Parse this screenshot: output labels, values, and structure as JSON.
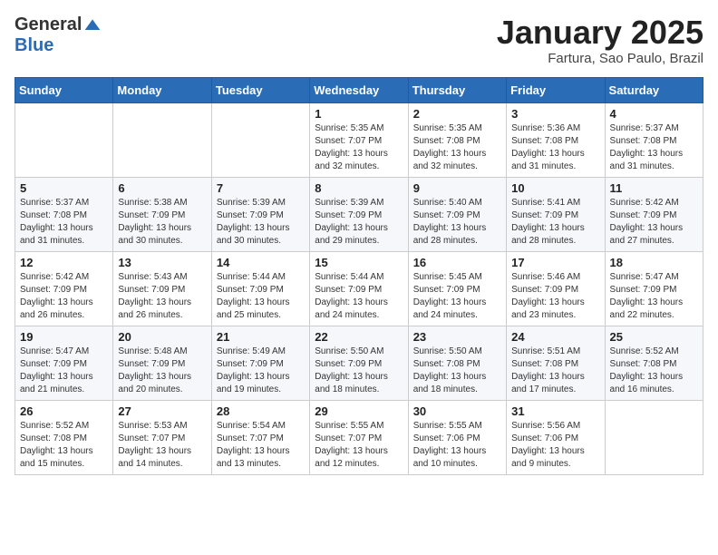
{
  "logo": {
    "general": "General",
    "blue": "Blue"
  },
  "title": "January 2025",
  "subtitle": "Fartura, Sao Paulo, Brazil",
  "days_header": [
    "Sunday",
    "Monday",
    "Tuesday",
    "Wednesday",
    "Thursday",
    "Friday",
    "Saturday"
  ],
  "weeks": [
    [
      {
        "day": "",
        "info": ""
      },
      {
        "day": "",
        "info": ""
      },
      {
        "day": "",
        "info": ""
      },
      {
        "day": "1",
        "info": "Sunrise: 5:35 AM\nSunset: 7:07 PM\nDaylight: 13 hours\nand 32 minutes."
      },
      {
        "day": "2",
        "info": "Sunrise: 5:35 AM\nSunset: 7:08 PM\nDaylight: 13 hours\nand 32 minutes."
      },
      {
        "day": "3",
        "info": "Sunrise: 5:36 AM\nSunset: 7:08 PM\nDaylight: 13 hours\nand 31 minutes."
      },
      {
        "day": "4",
        "info": "Sunrise: 5:37 AM\nSunset: 7:08 PM\nDaylight: 13 hours\nand 31 minutes."
      }
    ],
    [
      {
        "day": "5",
        "info": "Sunrise: 5:37 AM\nSunset: 7:08 PM\nDaylight: 13 hours\nand 31 minutes."
      },
      {
        "day": "6",
        "info": "Sunrise: 5:38 AM\nSunset: 7:09 PM\nDaylight: 13 hours\nand 30 minutes."
      },
      {
        "day": "7",
        "info": "Sunrise: 5:39 AM\nSunset: 7:09 PM\nDaylight: 13 hours\nand 30 minutes."
      },
      {
        "day": "8",
        "info": "Sunrise: 5:39 AM\nSunset: 7:09 PM\nDaylight: 13 hours\nand 29 minutes."
      },
      {
        "day": "9",
        "info": "Sunrise: 5:40 AM\nSunset: 7:09 PM\nDaylight: 13 hours\nand 28 minutes."
      },
      {
        "day": "10",
        "info": "Sunrise: 5:41 AM\nSunset: 7:09 PM\nDaylight: 13 hours\nand 28 minutes."
      },
      {
        "day": "11",
        "info": "Sunrise: 5:42 AM\nSunset: 7:09 PM\nDaylight: 13 hours\nand 27 minutes."
      }
    ],
    [
      {
        "day": "12",
        "info": "Sunrise: 5:42 AM\nSunset: 7:09 PM\nDaylight: 13 hours\nand 26 minutes."
      },
      {
        "day": "13",
        "info": "Sunrise: 5:43 AM\nSunset: 7:09 PM\nDaylight: 13 hours\nand 26 minutes."
      },
      {
        "day": "14",
        "info": "Sunrise: 5:44 AM\nSunset: 7:09 PM\nDaylight: 13 hours\nand 25 minutes."
      },
      {
        "day": "15",
        "info": "Sunrise: 5:44 AM\nSunset: 7:09 PM\nDaylight: 13 hours\nand 24 minutes."
      },
      {
        "day": "16",
        "info": "Sunrise: 5:45 AM\nSunset: 7:09 PM\nDaylight: 13 hours\nand 24 minutes."
      },
      {
        "day": "17",
        "info": "Sunrise: 5:46 AM\nSunset: 7:09 PM\nDaylight: 13 hours\nand 23 minutes."
      },
      {
        "day": "18",
        "info": "Sunrise: 5:47 AM\nSunset: 7:09 PM\nDaylight: 13 hours\nand 22 minutes."
      }
    ],
    [
      {
        "day": "19",
        "info": "Sunrise: 5:47 AM\nSunset: 7:09 PM\nDaylight: 13 hours\nand 21 minutes."
      },
      {
        "day": "20",
        "info": "Sunrise: 5:48 AM\nSunset: 7:09 PM\nDaylight: 13 hours\nand 20 minutes."
      },
      {
        "day": "21",
        "info": "Sunrise: 5:49 AM\nSunset: 7:09 PM\nDaylight: 13 hours\nand 19 minutes."
      },
      {
        "day": "22",
        "info": "Sunrise: 5:50 AM\nSunset: 7:09 PM\nDaylight: 13 hours\nand 18 minutes."
      },
      {
        "day": "23",
        "info": "Sunrise: 5:50 AM\nSunset: 7:08 PM\nDaylight: 13 hours\nand 18 minutes."
      },
      {
        "day": "24",
        "info": "Sunrise: 5:51 AM\nSunset: 7:08 PM\nDaylight: 13 hours\nand 17 minutes."
      },
      {
        "day": "25",
        "info": "Sunrise: 5:52 AM\nSunset: 7:08 PM\nDaylight: 13 hours\nand 16 minutes."
      }
    ],
    [
      {
        "day": "26",
        "info": "Sunrise: 5:52 AM\nSunset: 7:08 PM\nDaylight: 13 hours\nand 15 minutes."
      },
      {
        "day": "27",
        "info": "Sunrise: 5:53 AM\nSunset: 7:07 PM\nDaylight: 13 hours\nand 14 minutes."
      },
      {
        "day": "28",
        "info": "Sunrise: 5:54 AM\nSunset: 7:07 PM\nDaylight: 13 hours\nand 13 minutes."
      },
      {
        "day": "29",
        "info": "Sunrise: 5:55 AM\nSunset: 7:07 PM\nDaylight: 13 hours\nand 12 minutes."
      },
      {
        "day": "30",
        "info": "Sunrise: 5:55 AM\nSunset: 7:06 PM\nDaylight: 13 hours\nand 10 minutes."
      },
      {
        "day": "31",
        "info": "Sunrise: 5:56 AM\nSunset: 7:06 PM\nDaylight: 13 hours\nand 9 minutes."
      },
      {
        "day": "",
        "info": ""
      }
    ]
  ]
}
